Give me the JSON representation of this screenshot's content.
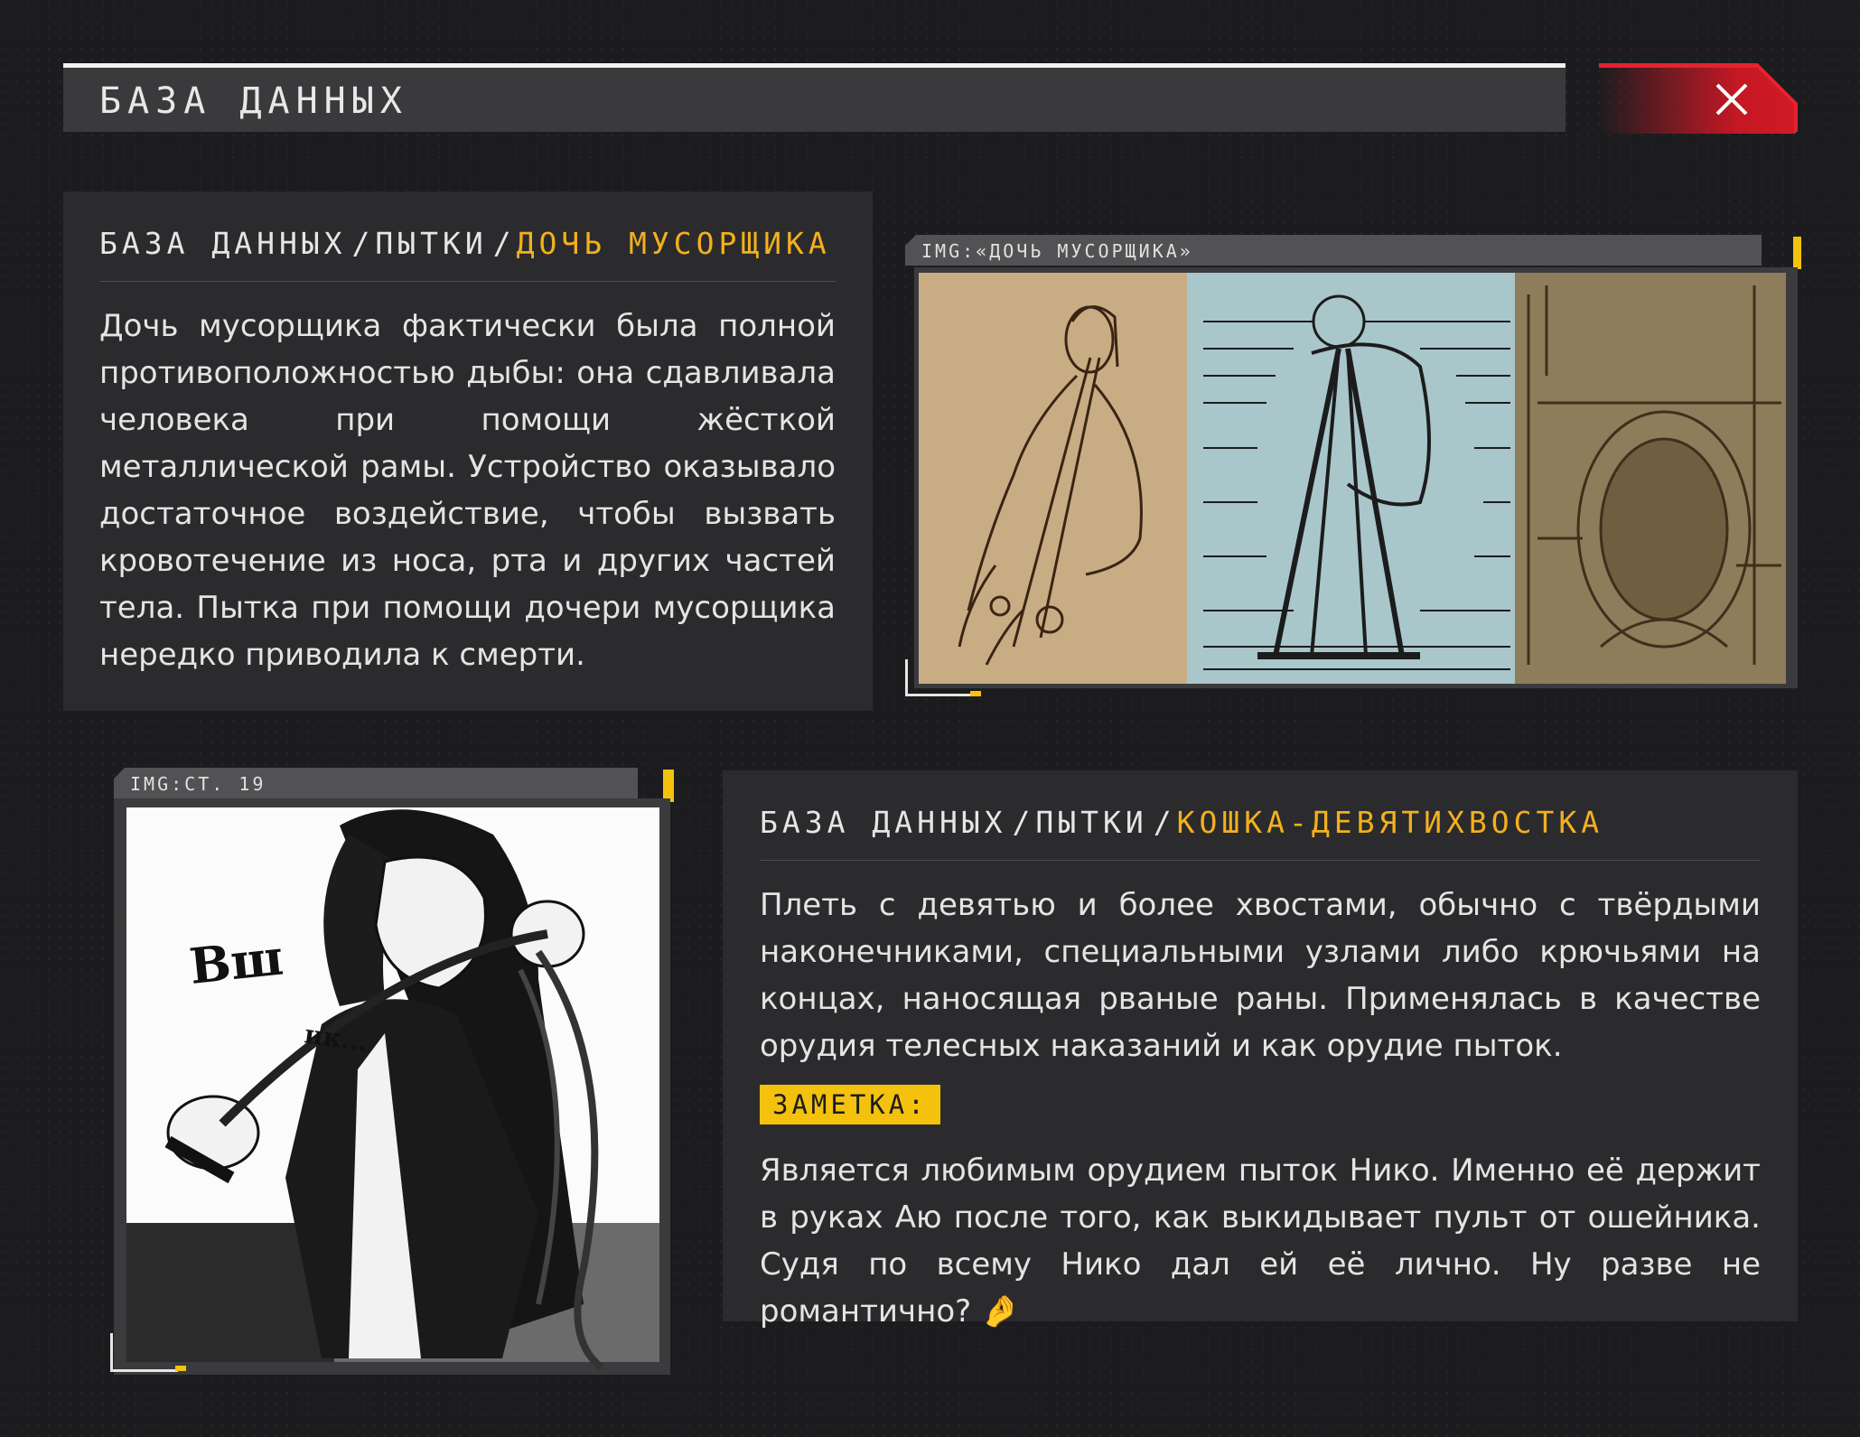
{
  "header": {
    "title": "БАЗА  ДАННЫХ"
  },
  "close": {
    "icon": "close-icon",
    "color": "#c41824"
  },
  "entry1": {
    "crumb_root": "БАЗА  ДАННЫХ",
    "crumb_mid": "ПЫТКИ",
    "crumb_active": "ДОЧЬ  МУСОРЩИКА",
    "text": "Дочь мусорщика фактически была полной противоположностью дыбы: она сдавливала человека при помощи жёсткой металлической рамы. Устройство оказывало достаточное воздействие, чтобы вызвать кровотечение из носа, рта и других частей тела. Пытка при помощи дочери мусорщика нередко приводила к смерти.",
    "image_tab": "IMG:«ДОЧЬ МУСОРЩИКА»"
  },
  "entry2": {
    "crumb_root": "БАЗА  ДАННЫХ",
    "crumb_mid": "ПЫТКИ",
    "crumb_active": "КОШКА-ДЕВЯТИХВОСТКА",
    "text": "Плеть с девятью и более хвостами, обычно с твёрдыми наконечниками, специальными узлами либо крючьями на концах, наносящая рваные раны. Применялась в качестве орудия телесных наказаний и как орудие пыток.",
    "note_label": "ЗАМЕТКА:",
    "note_text": "Является любимым орудием пыток Нико. Именно её держит в руках Аю после того, как выкидывает пульт от ошейника. Судя по всему Нико дал ей её лично. Ну разве не романтично?",
    "note_emoji": "🤌",
    "image_tab": "IMG:СТ. 19",
    "manga_sfx_1": "Вш",
    "manga_sfx_2": "ик..."
  },
  "colors": {
    "accent": "#f3b01e",
    "highlight": "#f4c20d",
    "panel": "#2b2b2d"
  }
}
